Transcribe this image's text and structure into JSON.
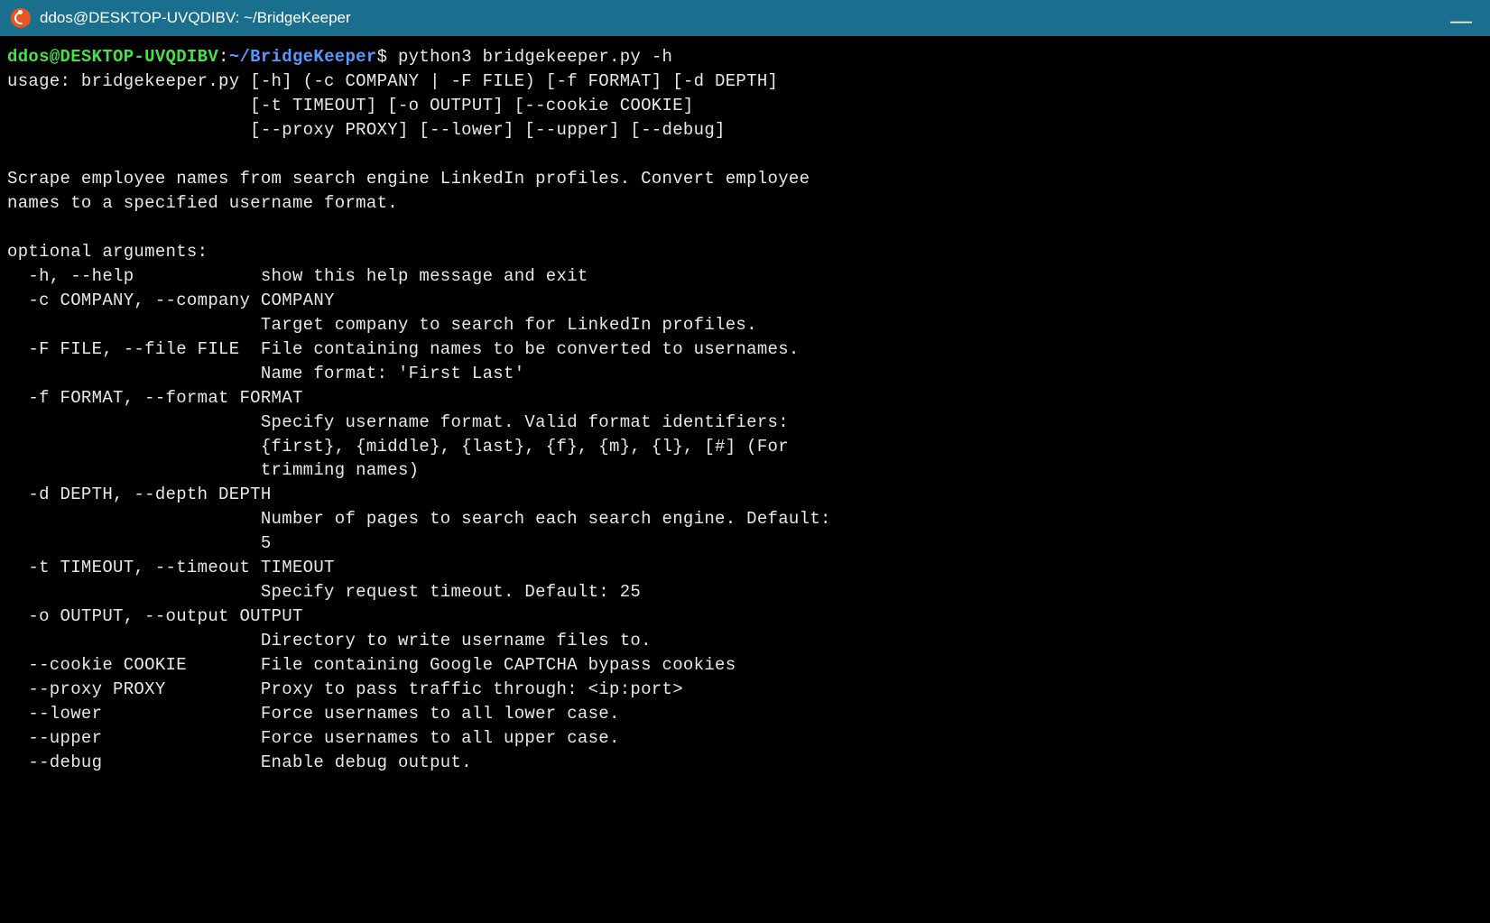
{
  "window": {
    "title": "ddos@DESKTOP-UVQDIBV: ~/BridgeKeeper"
  },
  "prompt": {
    "user_host": "ddos@DESKTOP-UVQDIBV",
    "colon": ":",
    "path_tilde": "~",
    "path_rest": "/BridgeKeeper",
    "dollar": "$"
  },
  "command": "python3 bridgekeeper.py -h",
  "output_lines": [
    "usage: bridgekeeper.py [-h] (-c COMPANY | -F FILE) [-f FORMAT] [-d DEPTH]",
    "                       [-t TIMEOUT] [-o OUTPUT] [--cookie COOKIE]",
    "                       [--proxy PROXY] [--lower] [--upper] [--debug]",
    "",
    "Scrape employee names from search engine LinkedIn profiles. Convert employee",
    "names to a specified username format.",
    "",
    "optional arguments:",
    "  -h, --help            show this help message and exit",
    "  -c COMPANY, --company COMPANY",
    "                        Target company to search for LinkedIn profiles.",
    "  -F FILE, --file FILE  File containing names to be converted to usernames.",
    "                        Name format: 'First Last'",
    "  -f FORMAT, --format FORMAT",
    "                        Specify username format. Valid format identifiers:",
    "                        {first}, {middle}, {last}, {f}, {m}, {l}, [#] (For",
    "                        trimming names)",
    "  -d DEPTH, --depth DEPTH",
    "                        Number of pages to search each search engine. Default:",
    "                        5",
    "  -t TIMEOUT, --timeout TIMEOUT",
    "                        Specify request timeout. Default: 25",
    "  -o OUTPUT, --output OUTPUT",
    "                        Directory to write username files to.",
    "  --cookie COOKIE       File containing Google CAPTCHA bypass cookies",
    "  --proxy PROXY         Proxy to pass traffic through: <ip:port>",
    "  --lower               Force usernames to all lower case.",
    "  --upper               Force usernames to all upper case.",
    "  --debug               Enable debug output."
  ]
}
